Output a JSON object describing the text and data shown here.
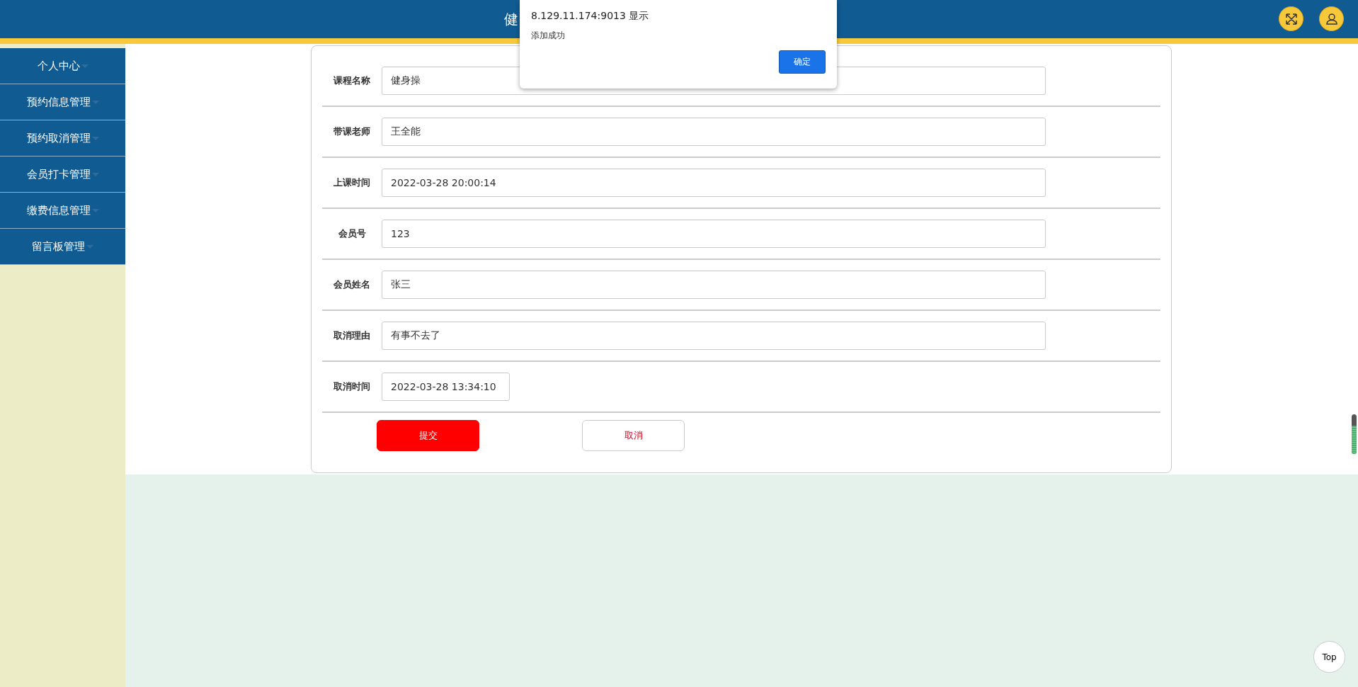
{
  "header": {
    "title": "健"
  },
  "sidebar": {
    "items": [
      {
        "label": "个人中心"
      },
      {
        "label": "预约信息管理"
      },
      {
        "label": "预约取消管理"
      },
      {
        "label": "会员打卡管理"
      },
      {
        "label": "缴费信息管理"
      },
      {
        "label": "留言板管理"
      }
    ]
  },
  "form": {
    "fields": [
      {
        "label": "课程名称",
        "value": "健身操",
        "kind": "wide"
      },
      {
        "label": "带课老师",
        "value": "王全能",
        "kind": "wide"
      },
      {
        "label": "上课时间",
        "value": "2022-03-28 20:00:14",
        "kind": "wide"
      },
      {
        "label": "会员号",
        "value": "123",
        "kind": "wide"
      },
      {
        "label": "会员姓名",
        "value": "张三",
        "kind": "wide"
      },
      {
        "label": "取消理由",
        "value": "有事不去了",
        "kind": "wide"
      },
      {
        "label": "取消时间",
        "value": "2022-03-28 13:34:10",
        "kind": "short"
      }
    ],
    "buttons": [
      {
        "label": "提交",
        "kind": "primary"
      },
      {
        "label": "取消",
        "kind": "secondary"
      }
    ]
  },
  "dialog": {
    "title": "8.129.11.174:9013 显示",
    "message": "添加成功",
    "button": "确定"
  },
  "top_button": "Top"
}
